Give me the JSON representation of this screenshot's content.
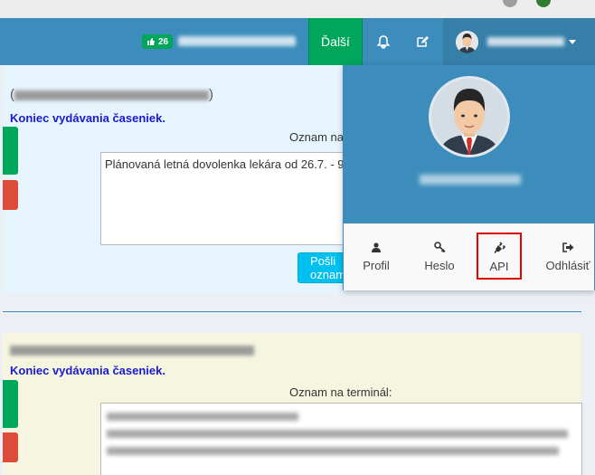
{
  "navbar": {
    "kudos_count": "26",
    "next_button": "Ďalší",
    "icons": [
      "thumbs-up-icon",
      "bell-icon",
      "edit-icon",
      "chevron-down-icon"
    ]
  },
  "user_dropdown": {
    "menu_items": [
      {
        "label": "Profil",
        "icon": "user-icon"
      },
      {
        "label": "Heslo",
        "icon": "key-icon"
      },
      {
        "label": "API",
        "icon": "plug-icon"
      },
      {
        "label": "Odhlásiť",
        "icon": "sign-out-icon"
      }
    ]
  },
  "panels": [
    {
      "status_text": "Koniec vydávania časeniek.",
      "notice_label": "Oznam na terminál:",
      "notice_text": "Plánovaná letná dovolenka lekára od 26.7. - 9.8.",
      "send_button": "Pošli oznam"
    },
    {
      "status_text": "Koniec vydávania časeniek.",
      "notice_label": "Oznam na terminál:"
    }
  ],
  "colors": {
    "navbar": "#3c8dbc",
    "success": "#00a65a",
    "danger": "#dd4b39",
    "info": "#00c0ef",
    "highlight": "#e30000"
  }
}
